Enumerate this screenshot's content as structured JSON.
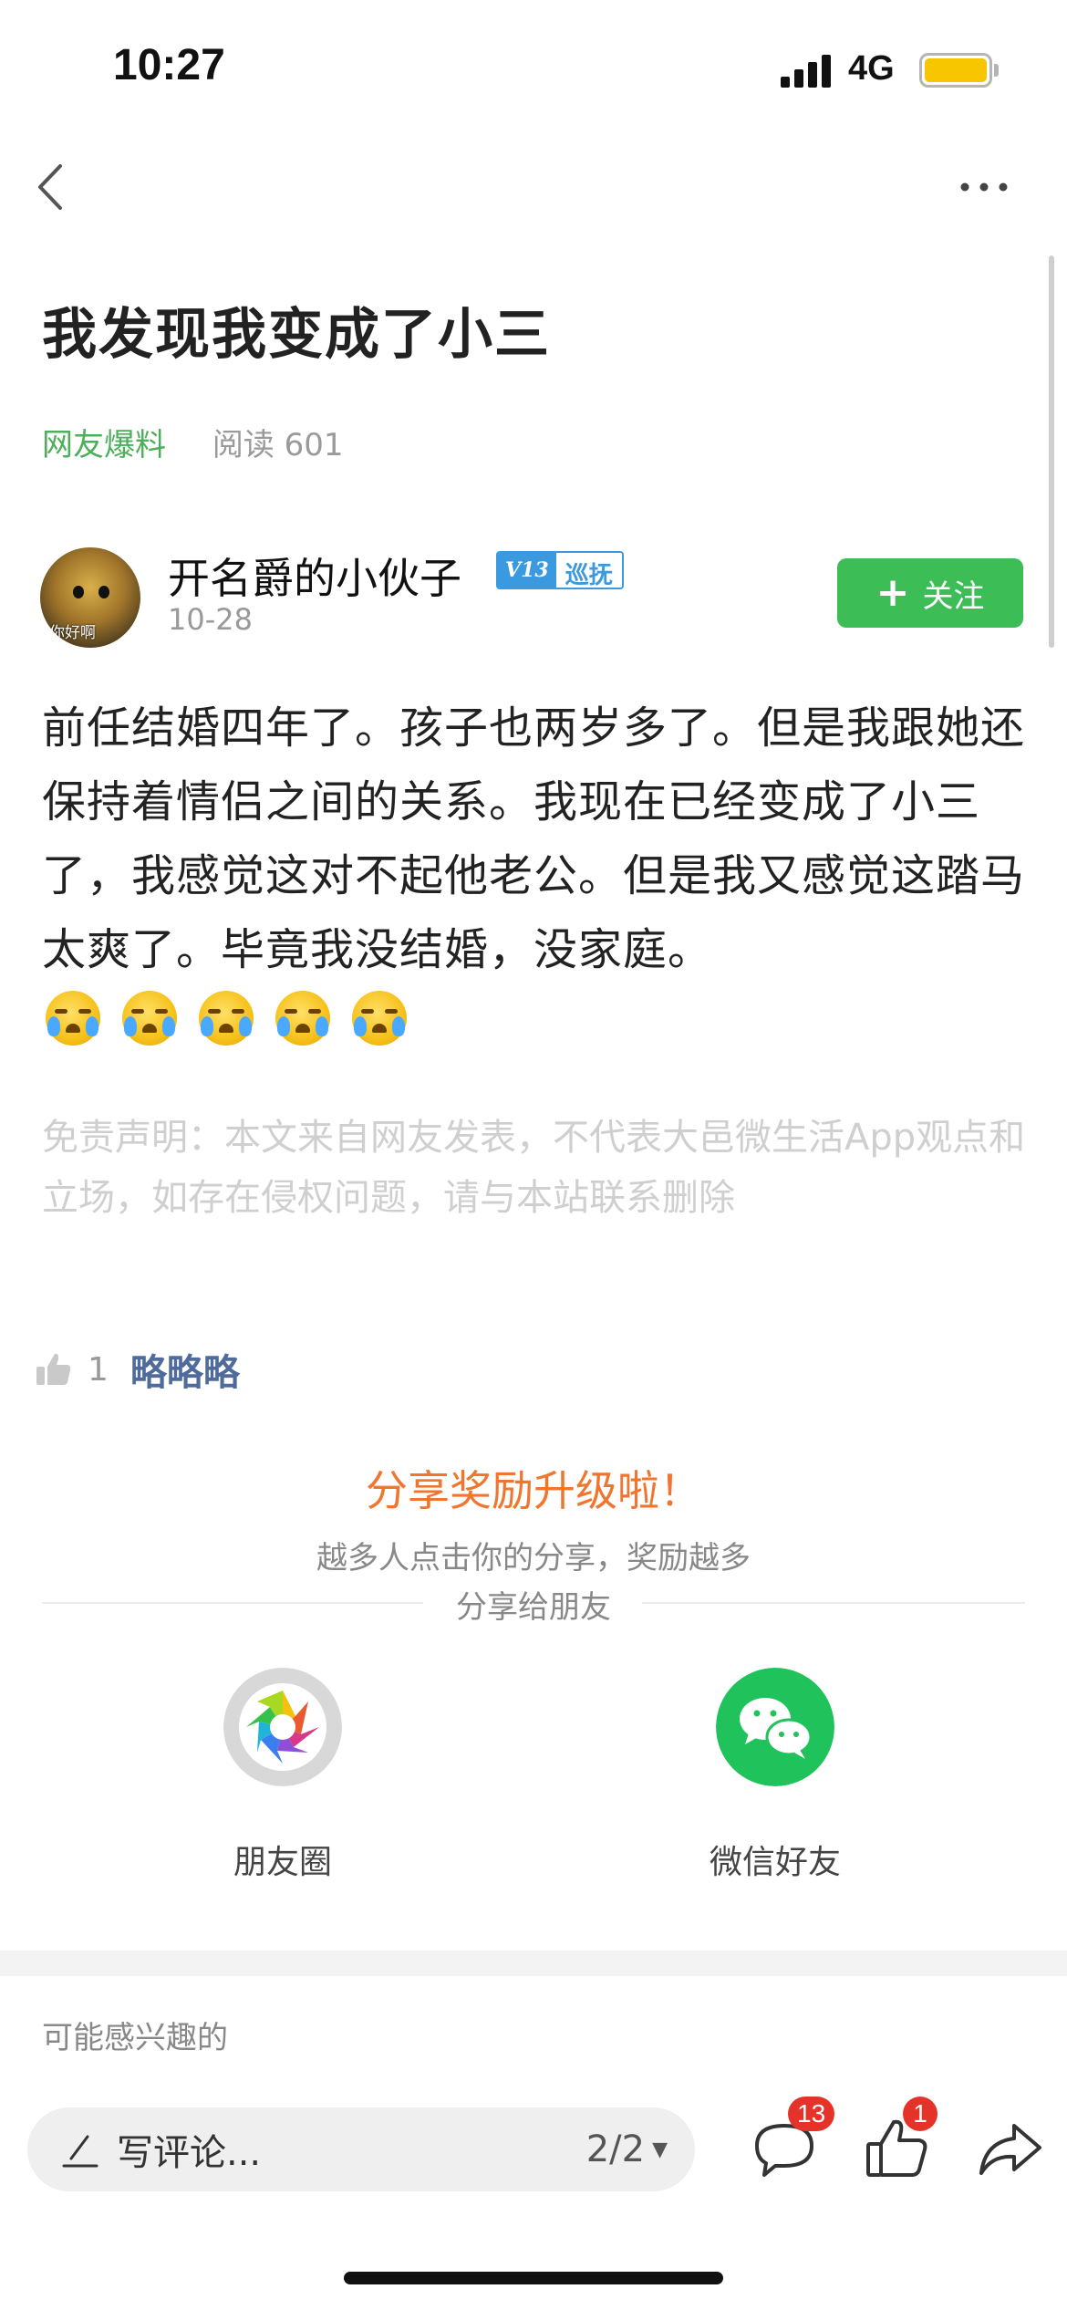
{
  "status_bar": {
    "time": "10:27",
    "network": "4G"
  },
  "article": {
    "title": "我发现我变成了小三",
    "category": "网友爆料",
    "read_count": "阅读 601"
  },
  "author": {
    "name": "开名爵的小伙子",
    "badge_level": "V13",
    "badge_text": "巡抚",
    "date": "10-28",
    "avatar_text": "你好啊",
    "follow_label": "关注"
  },
  "content": {
    "text": "前任结婚四年了。孩子也两岁多了。但是我跟她还保持着情侣之间的关系。我现在已经变成了小三了，我感觉这对不起他老公。但是我又感觉这踏马太爽了。毕竟我没结婚，没家庭。",
    "emoji_name": "crying-laughing-emoji",
    "emoji_count": 5
  },
  "disclaimer": "免责声明：本文来自网友发表，不代表大邑微生活App观点和立场，如存在侵权问题，请与本站联系删除",
  "likes": {
    "count": "1",
    "names": "略略略"
  },
  "share": {
    "title": "分享奖励升级啦！",
    "subtitle": "越多人点击你的分享，奖励越多",
    "friends_label": "分享给朋友",
    "moments_label": "朋友圈",
    "wechat_label": "微信好友"
  },
  "interest_label": "可能感兴趣的",
  "bottom_bar": {
    "comment_placeholder": "写评论...",
    "page_indicator": "2/2",
    "comment_count": "13",
    "like_count": "1"
  },
  "colors": {
    "accent_green": "#3dbd55",
    "category_green": "#4cb05a",
    "share_orange": "#f0762f",
    "badge_red": "#e5332a",
    "like_names_blue": "#4f6b9c"
  }
}
